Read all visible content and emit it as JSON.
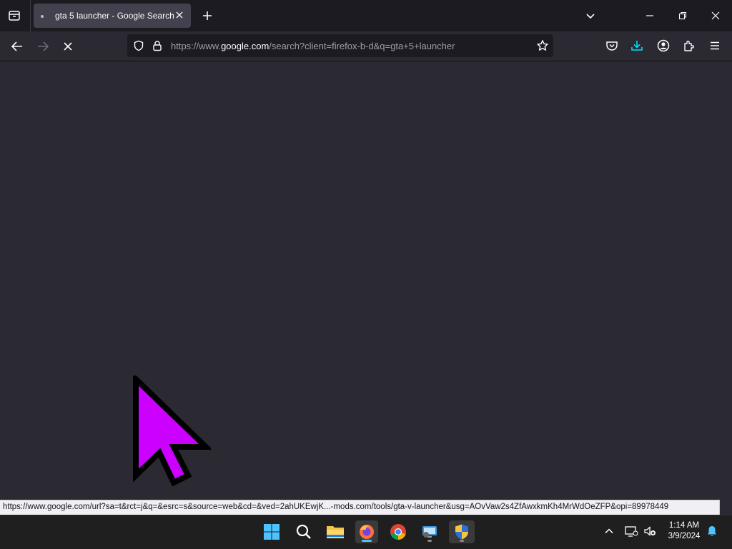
{
  "browser": {
    "tab": {
      "title": "gta 5 launcher - Google Search"
    },
    "url": {
      "scheme_prefix": "https://www.",
      "host": "google.com",
      "rest": "/search?client=firefox-b-d&q=gta+5+launcher"
    }
  },
  "status_bar": {
    "link": "https://www.google.com/url?sa=t&rct=j&q=&esrc=s&source=web&cd=&ved=2ahUKEwjK...-mods.com/tools/gta-v-launcher&usg=AOvVaw2s4ZfAwxkmKh4MrWdOeZFP&opi=89978449"
  },
  "taskbar": {
    "apps": [
      "start-icon",
      "search-icon",
      "file-explorer-icon",
      "firefox-icon",
      "chrome-icon",
      "remote-desktop-icon",
      "security-shield-icon"
    ],
    "clock": {
      "time": "1:14 AM",
      "date": "3/9/2024"
    }
  },
  "colors": {
    "cursor_fill": "#cc00ff",
    "accent_download": "#00ddff",
    "taskbar_active": "#4cc2ff"
  }
}
